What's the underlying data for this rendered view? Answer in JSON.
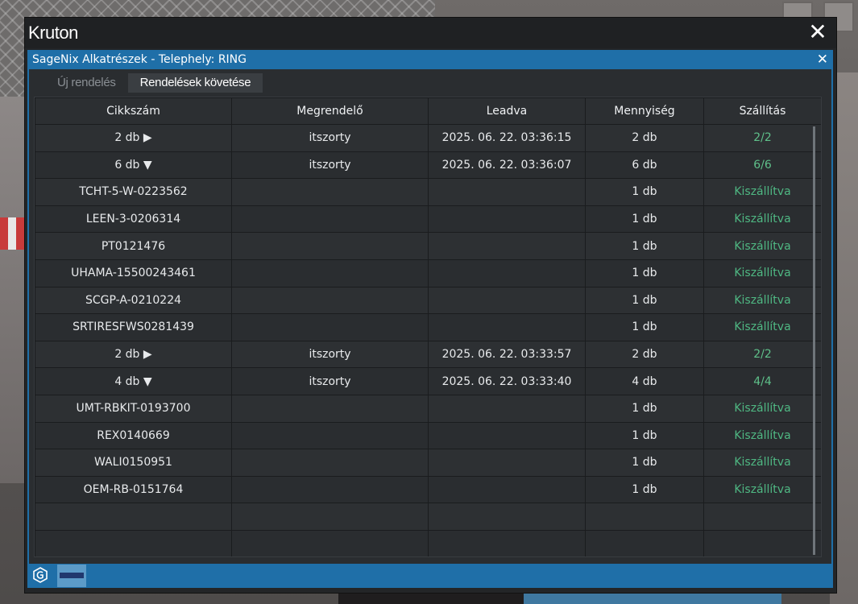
{
  "window": {
    "title": "Kruton",
    "close_icon": "close-icon"
  },
  "panel": {
    "title": "SageNix Alkatrészek - Telephely: RING",
    "close_icon": "close-icon"
  },
  "tabs": [
    {
      "label": "Új rendelés",
      "active": false
    },
    {
      "label": "Rendelések követése",
      "active": true
    }
  ],
  "table": {
    "headers": [
      "Cikkszám",
      "Megrendelő",
      "Leadva",
      "Mennyiség",
      "Szállítás"
    ],
    "rows": [
      [
        "2 db ▶",
        "itszorty",
        "2025. 06. 22. 03:36:15",
        "2 db",
        "2/2"
      ],
      [
        "6 db ▼",
        "itszorty",
        "2025. 06. 22. 03:36:07",
        "6 db",
        "6/6"
      ],
      [
        "TCHT-5-W-0223562",
        "",
        "",
        "1 db",
        "Kiszállítva"
      ],
      [
        "LEEN-3-0206314",
        "",
        "",
        "1 db",
        "Kiszállítva"
      ],
      [
        "PT0121476",
        "",
        "",
        "1 db",
        "Kiszállítva"
      ],
      [
        "UHAMA-15500243461",
        "",
        "",
        "1 db",
        "Kiszállítva"
      ],
      [
        "SCGP-A-0210224",
        "",
        "",
        "1 db",
        "Kiszállítva"
      ],
      [
        "SRTIRESFWS0281439",
        "",
        "",
        "1 db",
        "Kiszállítva"
      ],
      [
        "2 db ▶",
        "itszorty",
        "2025. 06. 22. 03:33:57",
        "2 db",
        "2/2"
      ],
      [
        "4 db ▼",
        "itszorty",
        "2025. 06. 22. 03:33:40",
        "4 db",
        "4/4"
      ],
      [
        "UMT-RBKIT-0193700",
        "",
        "",
        "1 db",
        "Kiszállítva"
      ],
      [
        "REX0140669",
        "",
        "",
        "1 db",
        "Kiszállítva"
      ],
      [
        "WALI0150951",
        "",
        "",
        "1 db",
        "Kiszállítva"
      ],
      [
        "OEM-RB-0151764",
        "",
        "",
        "1 db",
        "Kiszállítva"
      ],
      [
        "",
        "",
        "",
        "",
        ""
      ],
      [
        "",
        "",
        "",
        "",
        ""
      ]
    ]
  },
  "bottom_bar": {
    "icons": [
      "app-logo-icon",
      "brand-logo-icon"
    ]
  },
  "colors": {
    "accent": "#1f6fa8",
    "status_green": "#4fb883"
  }
}
